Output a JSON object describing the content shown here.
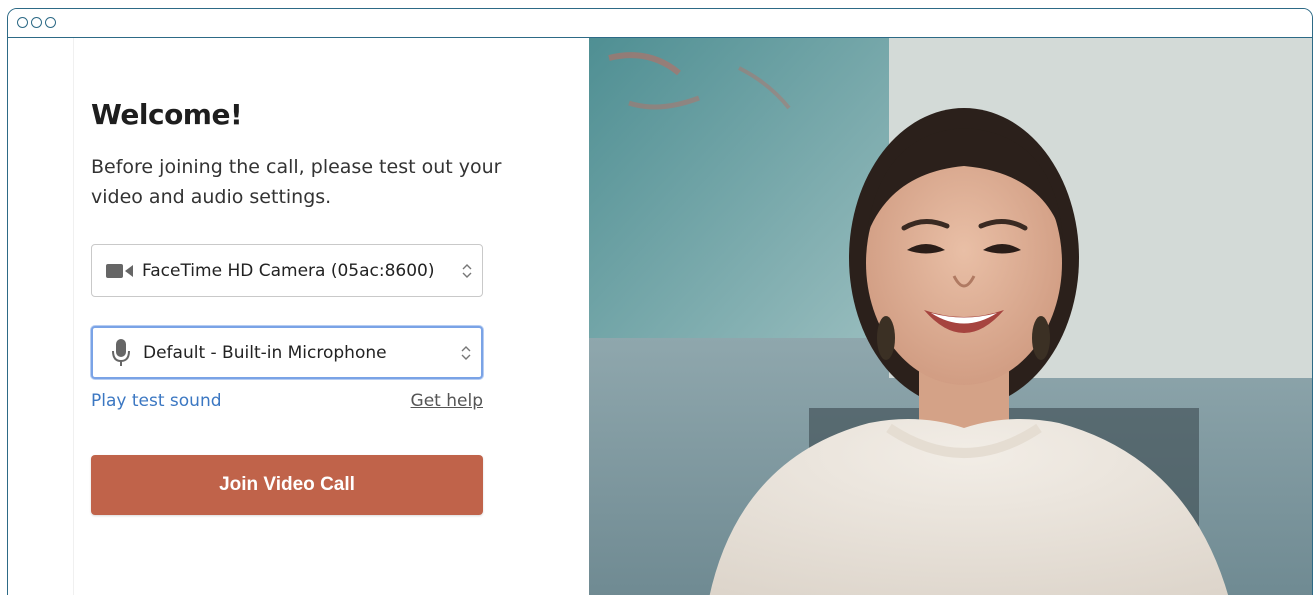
{
  "panel": {
    "title": "Welcome!",
    "subtitle": "Before joining the call, please test out your video and audio settings.",
    "camera_select": {
      "value": "FaceTime HD Camera (05ac:8600)",
      "icon": "video-camera-icon"
    },
    "mic_select": {
      "value": "Default - Built-in Microphone",
      "icon": "microphone-icon"
    },
    "play_test_sound": "Play test sound",
    "get_help": "Get help",
    "join_button": "Join Video Call"
  },
  "colors": {
    "window_border": "#2d6a86",
    "join_button": "#c0634a",
    "link": "#3b77c2",
    "focus_ring": "#7aa3e6"
  }
}
